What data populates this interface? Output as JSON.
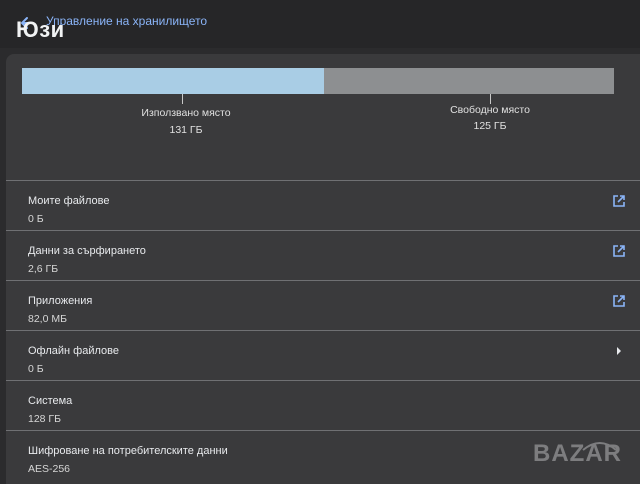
{
  "header": {
    "title": "Управление на хранилището",
    "overlay_logo": "Юзи"
  },
  "storage": {
    "used_label": "Използвано място",
    "used_value": "131 ГБ",
    "free_label": "Свободно място",
    "free_value": "125 ГБ",
    "used_fraction": 0.51
  },
  "items": [
    {
      "title": "Моите файлове",
      "value": "0 Б",
      "icon": "open-external-icon"
    },
    {
      "title": "Данни за сърфирането",
      "value": "2,6 ГБ",
      "icon": "open-external-icon"
    },
    {
      "title": "Приложения",
      "value": "82,0 МБ",
      "icon": "open-external-icon"
    },
    {
      "title": "Офлайн файлове",
      "value": "0 Б",
      "icon": "chevron-right-icon"
    },
    {
      "title": "Система",
      "value": "128 ГБ",
      "icon": ""
    },
    {
      "title": "Шифроване на потребителските данни",
      "value": "AES-256",
      "icon": ""
    }
  ],
  "watermark": {
    "text": "BAZAR"
  },
  "colors": {
    "accent": "#8ab4f8",
    "used_bar": "#a9cde5",
    "free_bar": "#8d8f91",
    "panel": "#3a3a3c",
    "background": "#2b2b2d"
  }
}
